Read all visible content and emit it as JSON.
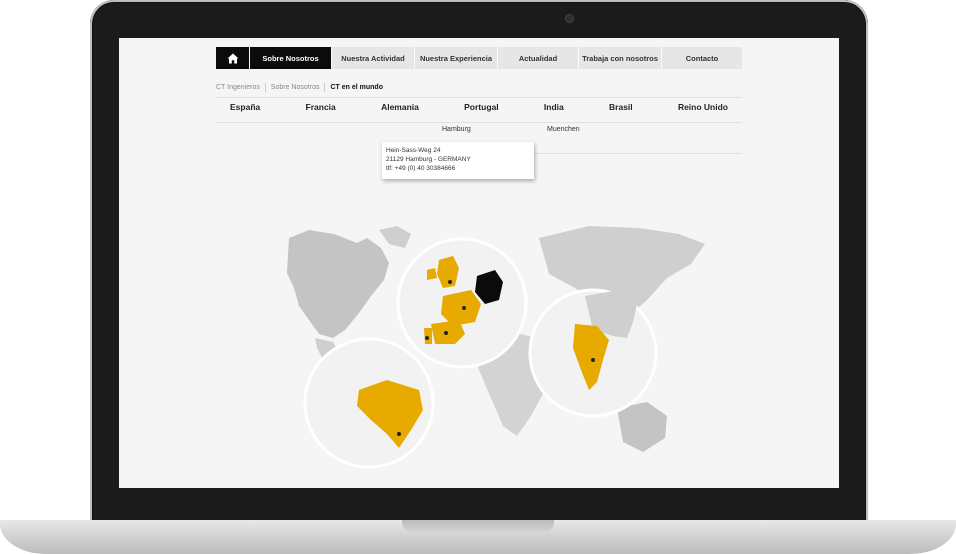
{
  "nav": {
    "items": [
      "Sobre Nosotros",
      "Nuestra Actividad",
      "Nuestra Experiencia",
      "Actualidad",
      "Trabaja con nosotros",
      "Contacto"
    ],
    "active_index": 0,
    "home_icon": "home-icon"
  },
  "breadcrumb": {
    "items": [
      "CT Ingenieros",
      "Sobre Nosotros"
    ],
    "current": "CT en el mundo"
  },
  "countries": [
    "España",
    "Francia",
    "Alemania",
    "Portugal",
    "India",
    "Brasil",
    "Reino Unido"
  ],
  "cities": [
    "Hamburg",
    "Muenchen"
  ],
  "tooltip": {
    "address": "Hein-Sass-Weg 24",
    "city": "21129 Hamburg - GERMANY",
    "phone": "tlf: +49 (0) 40 30384666"
  },
  "colors": {
    "accent": "#e6aa00",
    "selected": "#0b0b0b",
    "map_land": "#cfcfcf",
    "nav_bg": "#e6e6e6"
  }
}
